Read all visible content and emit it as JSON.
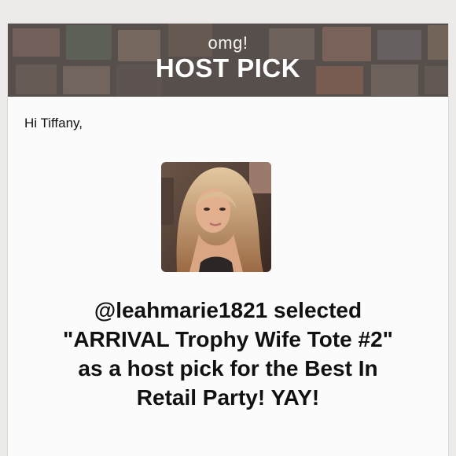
{
  "header": {
    "kicker": "omg!",
    "title": "HOST PICK"
  },
  "greeting": "Hi Tiffany,",
  "avatar": {
    "icon": "user-avatar-photo"
  },
  "message": {
    "line1": "@leahmarie1821 selected",
    "line2": "\"ARRIVAL Trophy Wife Tote #2\"",
    "line3": "as a host pick for the Best In",
    "line4": "Retail Party! YAY!"
  },
  "colors": {
    "background": "#ecebe9",
    "card": "#fbfbfb",
    "header_shade": "#5f5753",
    "text": "#111111"
  }
}
